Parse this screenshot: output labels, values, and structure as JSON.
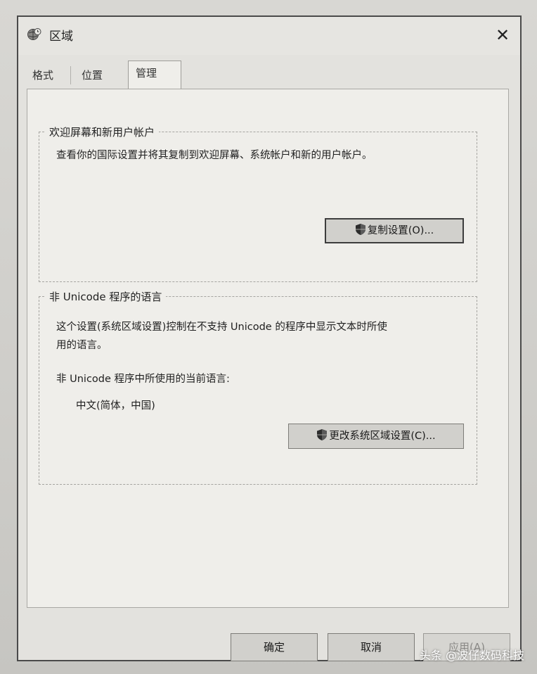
{
  "window": {
    "title": "区域",
    "close_symbol": "✕",
    "icon": "globe-clock-icon"
  },
  "tabs": [
    {
      "label": "格式",
      "selected": false
    },
    {
      "label": "位置",
      "selected": false
    },
    {
      "label": "管理",
      "selected": true
    }
  ],
  "welcome_group": {
    "title": "欢迎屏幕和新用户帐户",
    "description": "查看你的国际设置并将其复制到欢迎屏幕、系统帐户和新的用户帐户。",
    "button_label": "复制设置(O)...",
    "button_icon": "uac-shield-icon"
  },
  "unicode_group": {
    "title": "非 Unicode 程序的语言",
    "description_line1": "这个设置(系统区域设置)控制在不支持 Unicode 的程序中显示文本时所使",
    "description_line2": "用的语言。",
    "current_label": "非 Unicode 程序中所使用的当前语言:",
    "current_value": "中文(简体，中国)",
    "button_label": "更改系统区域设置(C)...",
    "button_icon": "uac-shield-icon"
  },
  "footer": {
    "ok_label": "确定",
    "cancel_label": "取消",
    "apply_label": "应用(A)",
    "apply_enabled": false
  },
  "watermark": "头条 @波仔数码科技"
}
